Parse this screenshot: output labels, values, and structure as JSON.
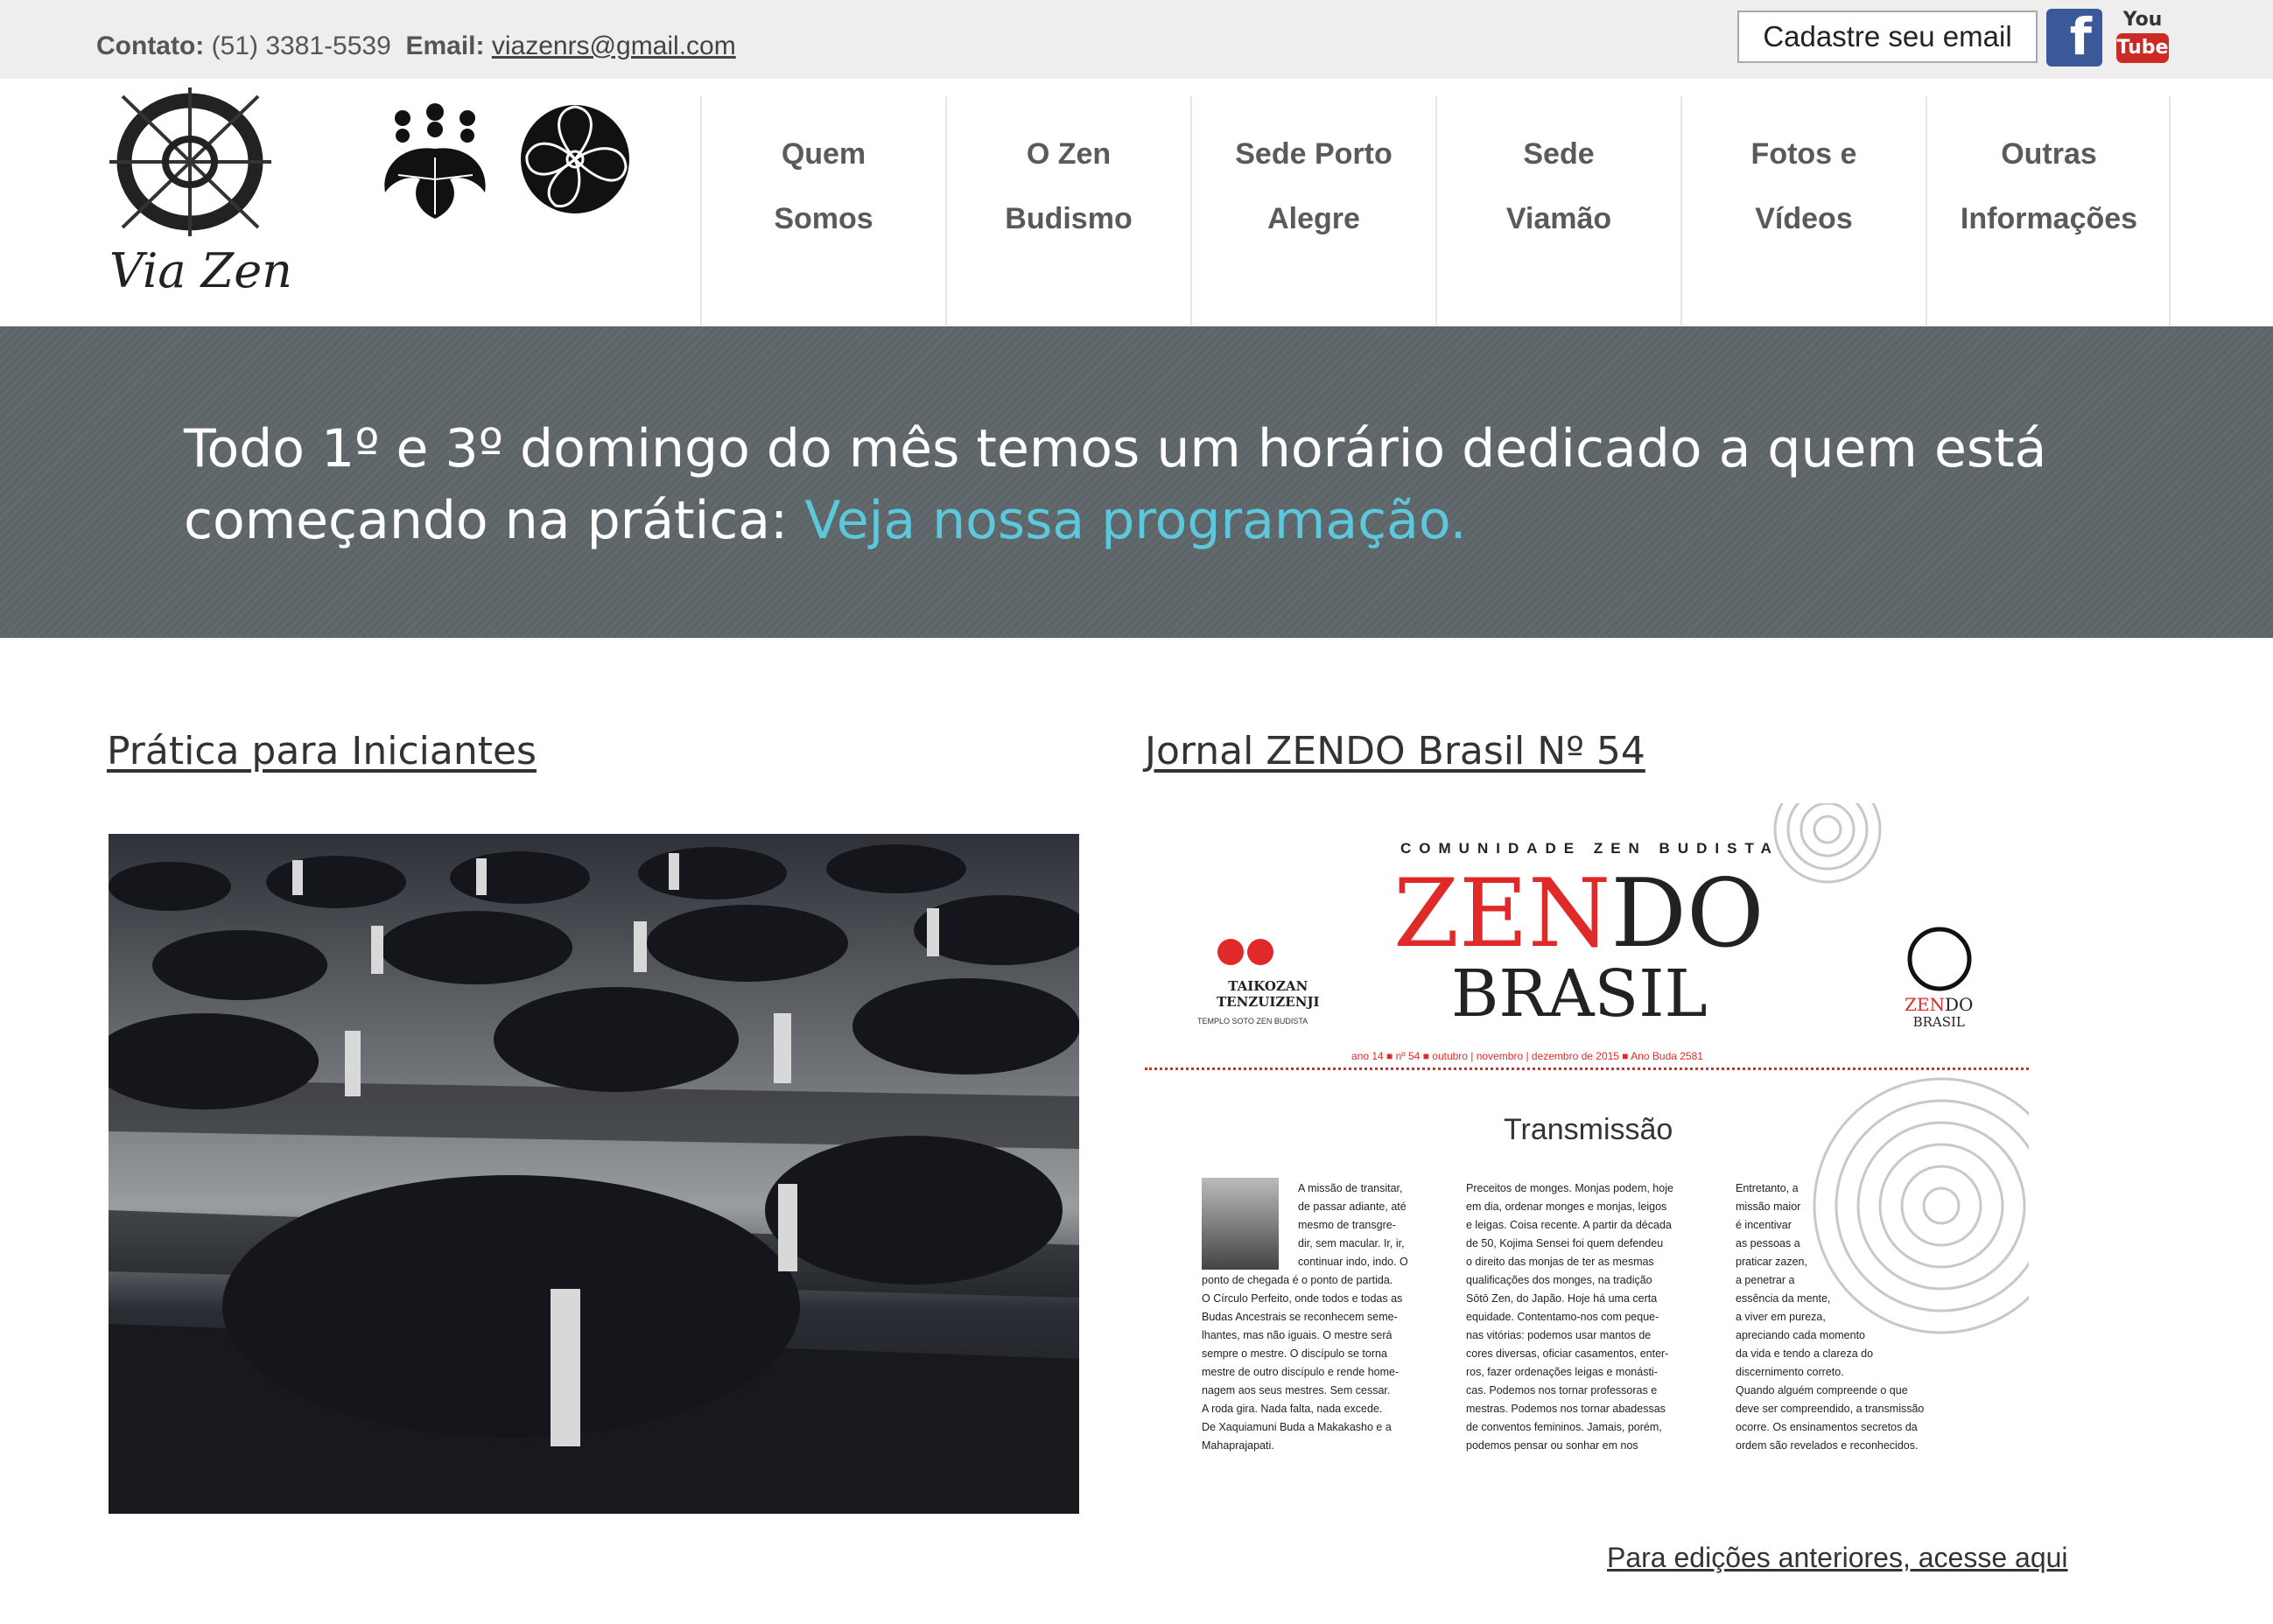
{
  "topbar": {
    "contact_label": "Contato:",
    "phone": "(51) 3381-5539",
    "email_label": "Email:",
    "email": "viazenrs@gmail.com",
    "signup_label": "Cadastre seu email",
    "facebook_icon": "facebook-icon",
    "youtube_icon": "youtube-icon",
    "youtube_top": "You",
    "youtube_bottom": "Tube"
  },
  "header": {
    "logo_text": "Via Zen",
    "nav": [
      {
        "line1": "Quem",
        "line2": "Somos"
      },
      {
        "line1": "O Zen",
        "line2": "Budismo"
      },
      {
        "line1": "Sede Porto",
        "line2": "Alegre"
      },
      {
        "line1": "Sede",
        "line2": "Viamão"
      },
      {
        "line1": "Fotos e",
        "line2": "Vídeos"
      },
      {
        "line1": "Outras",
        "line2": "Informações"
      }
    ]
  },
  "banner": {
    "text": "Todo 1º e 3º domingo do mês temos um horário dedicado a quem está começando na prática: ",
    "link": "Veja nossa programação."
  },
  "left_section": {
    "title": "Prática para Iniciantes"
  },
  "right_section": {
    "title": "Jornal ZENDO Brasil Nº 54",
    "journal": {
      "kicker": "COMUNIDADE ZEN BUDISTA",
      "zen": "ZEN",
      "do": "DO",
      "brasil": "BRASIL",
      "temple_name1": "TAIKOZAN",
      "temple_name2": "TENZUIZENJI",
      "temple_sub": "TEMPLO SOTO ZEN BUDISTA",
      "small_zen": "ZEN",
      "small_do": "DO",
      "small_brasil": "BRASIL",
      "issue_line": "ano 14 ■ nº 54 ■ outubro | novembro | dezembro de 2015 ■ Ano Buda 2581",
      "headline": "Transmissão",
      "col1": [
        "A missão de transitar,",
        "de passar adiante, até",
        "mesmo de transgre-",
        "dir, sem macular. Ir, ir,",
        "continuar indo, indo. O",
        "ponto de chegada é o ponto de partida.",
        "O Círculo Perfeito, onde todos e todas as",
        "Budas Ancestrais se reconhecem seme-",
        "lhantes, mas não iguais. O mestre será",
        "sempre o mestre. O discípulo se torna",
        "mestre de outro discípulo e rende home-",
        "nagem aos seus mestres. Sem cessar.",
        "A roda gira. Nada falta, nada excede.",
        "De Xaquiamuni Buda a Makakasho e a",
        "Mahaprajapati."
      ],
      "col2": [
        "Preceitos de monges. Monjas podem, hoje",
        "em dia, ordenar monges e monjas, leigos",
        "e leigas. Coisa recente. A partir da década",
        "de 50, Kojima Sensei foi quem defendeu",
        "o direito das monjas de ter as mesmas",
        "qualificações dos monges, na tradição",
        "Sōtō Zen, do Japão. Hoje há uma certa",
        "equidade. Contentamo-nos com peque-",
        "nas vitórias: podemos usar mantos de",
        "cores diversas, oficiar casamentos, enter-",
        "ros, fazer ordenações leigas e monásti-",
        "cas. Podemos nos tornar professoras e",
        "mestras. Podemos nos tornar abadessas",
        "de conventos femininos. Jamais, porém,",
        "podemos pensar ou sonhar em nos"
      ],
      "col3": [
        "Entretanto, a",
        "missão maior",
        "é incentivar",
        "as pessoas a",
        "praticar zazen,",
        "a penetrar a",
        "essência da mente,",
        "a viver em pureza,",
        "apreciando cada momento",
        "da vida e tendo a clareza do",
        "discernimento correto.",
        "   Quando alguém compreende o que",
        "deve ser compreendido, a transmissão",
        "ocorre. Os ensinamentos secretos da",
        "ordem são revelados e reconhecidos."
      ]
    },
    "previous_link": "Para edições anteriores, acesse aqui"
  },
  "colors": {
    "banner_bg": "#5d6569",
    "banner_link": "#5bc8dc",
    "topbar_bg": "#eeeeee",
    "journal_red": "#e02a2a",
    "facebook_blue": "#3b5998",
    "youtube_red": "#cc2a25"
  }
}
